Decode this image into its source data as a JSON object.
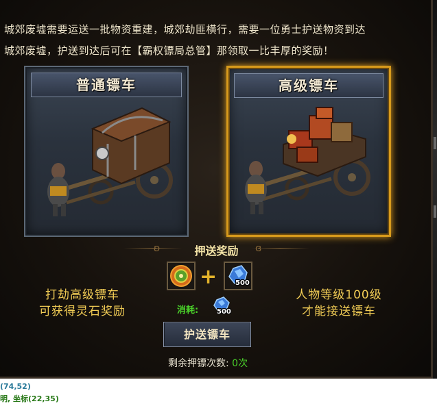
{
  "description": {
    "line1": "城郊废墟需要运送一批物资重建，城郊劫匪横行，需要一位勇士护送物资到达",
    "line2": "城郊废墟，护送到达后可在【霸权镖局总管】那领取一比丰厚的奖励！"
  },
  "carts": [
    {
      "title": "普通镖车",
      "selected": false
    },
    {
      "title": "高级镖车",
      "selected": true
    }
  ],
  "reward": {
    "section_title": "押送奖励",
    "items": [
      {
        "icon": "spirit-orb-icon",
        "qty": ""
      },
      {
        "icon": "blue-crystal-icon",
        "qty": "500"
      }
    ]
  },
  "left_note": {
    "line1": "打劫高级镖车",
    "line2": "可获得灵石奖励"
  },
  "right_note": {
    "line1": "人物等级100级",
    "line2": "才能接送镖车"
  },
  "cost": {
    "label": "消耗:",
    "qty": "500",
    "icon": "blue-crystal-icon"
  },
  "escort_button": "护送镖车",
  "remaining": {
    "label": "剩余押镖次数:",
    "count": "0次"
  },
  "status_lines": [
    "(74,52)",
    "明, 坐标(22,35)"
  ],
  "colors": {
    "gold_border": "#d79a1c",
    "green_text": "#4ad02a",
    "note_gold": "#f1cc55"
  }
}
